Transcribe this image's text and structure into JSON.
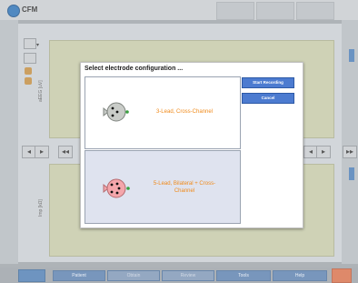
{
  "app": {
    "title": "CFM"
  },
  "plot_top": {
    "ylabel": "aEEG [uV]"
  },
  "plot_bottom": {
    "ylabel": "Imp [kΩ]"
  },
  "bottom_bar": {
    "buttons": [
      {
        "label": "Patient",
        "enabled": true
      },
      {
        "label": "Obtain",
        "enabled": false
      },
      {
        "label": "Review",
        "enabled": false
      },
      {
        "label": "Tools",
        "enabled": true
      },
      {
        "label": "Help",
        "enabled": true
      }
    ]
  },
  "dialog": {
    "title": "Select electrode configuration ...",
    "start_button": "Start Recording",
    "cancel_button": "Cancel",
    "options": [
      {
        "label": "3-Lead, Cross-Channel",
        "selected": false,
        "head_color": "#c9ccc8"
      },
      {
        "label": "5-Lead, Bilateral + Cross-Channel",
        "selected": true,
        "head_color": "#f4a6ab"
      }
    ]
  },
  "colors": {
    "accent_button": "#4c7bd0",
    "option_label": "#f08a1a",
    "plot_bg": "#c5c9a6"
  }
}
